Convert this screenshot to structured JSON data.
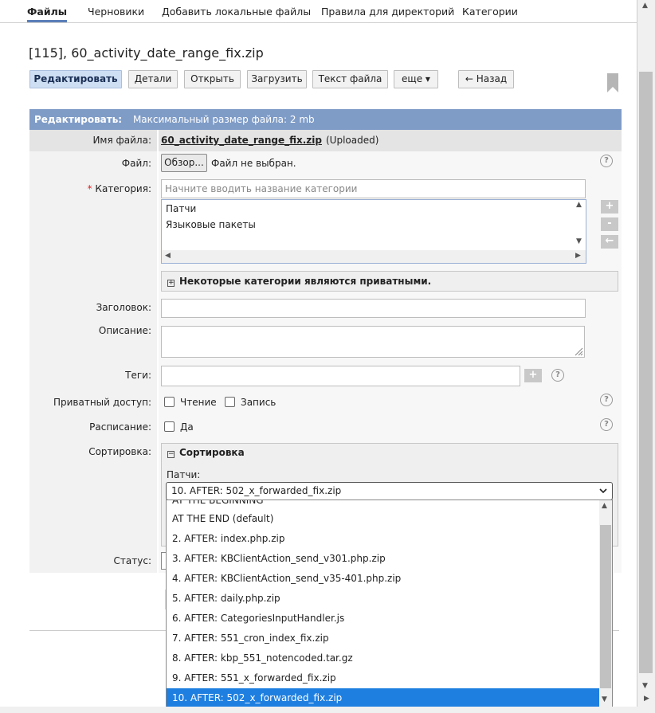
{
  "tabs": [
    "Файлы",
    "Черновики",
    "Добавить локальные файлы",
    "Правила для директорий",
    "Категории"
  ],
  "title": "[115], 60_activity_date_range_fix.zip",
  "actions": {
    "edit": "Редактировать",
    "details": "Детали",
    "open": "Открыть",
    "upload": "Загрузить",
    "text": "Текст файла",
    "more": "еще ▾",
    "back": "← Назад"
  },
  "form": {
    "header_title": "Редактировать:",
    "header_note": "Максимальный размер файла: 2 mb",
    "filename_label": "Имя файла:",
    "filename_value": "60_activity_date_range_fix.zip",
    "filename_status": "(Uploaded)",
    "file_label": "Файл:",
    "browse_button": "Обзор...",
    "no_file": "Файл не выбран.",
    "required_mark": "*",
    "category_label": "Категория:",
    "category_placeholder": "Начните вводить название категории",
    "categories": [
      "Патчи",
      "Языковые пакеты"
    ],
    "private_categories_note": "Некоторые категории являются приватными.",
    "heading_label": "Заголовок:",
    "description_label": "Описание:",
    "tags_label": "Теги:",
    "private_access_label": "Приватный доступ:",
    "read_label": "Чтение",
    "write_label": "Запись",
    "schedule_label": "Расписание:",
    "schedule_yes": "Да",
    "sort_label": "Сортировка:",
    "sort_box_title": "Сортировка",
    "sort_category": "Патчи:",
    "sort_selected": "10. AFTER: 502_x_forwarded_fix.zip",
    "status_label": "Статус:"
  },
  "dropdown_options": [
    "AT THE BEGINNING",
    "AT THE END (default)",
    "2. AFTER: index.php.zip",
    "3. AFTER: KBClientAction_send_v301.php.zip",
    "4. AFTER: KBClientAction_send_v35-401.php.zip",
    "5. AFTER: daily.php.zip",
    "6. AFTER: CategoriesInputHandler.js",
    "7. AFTER: 551_cron_index_fix.zip",
    "8. AFTER: kbp_551_notencoded.tar.gz",
    "9. AFTER: 551_x_forwarded_fix.zip",
    "10. AFTER: 502_x_forwarded_fix.zip"
  ],
  "colors": {
    "accent": "#7f9cc7",
    "selected_option": "#1e7fe0",
    "active_button": "#cfdff3"
  }
}
